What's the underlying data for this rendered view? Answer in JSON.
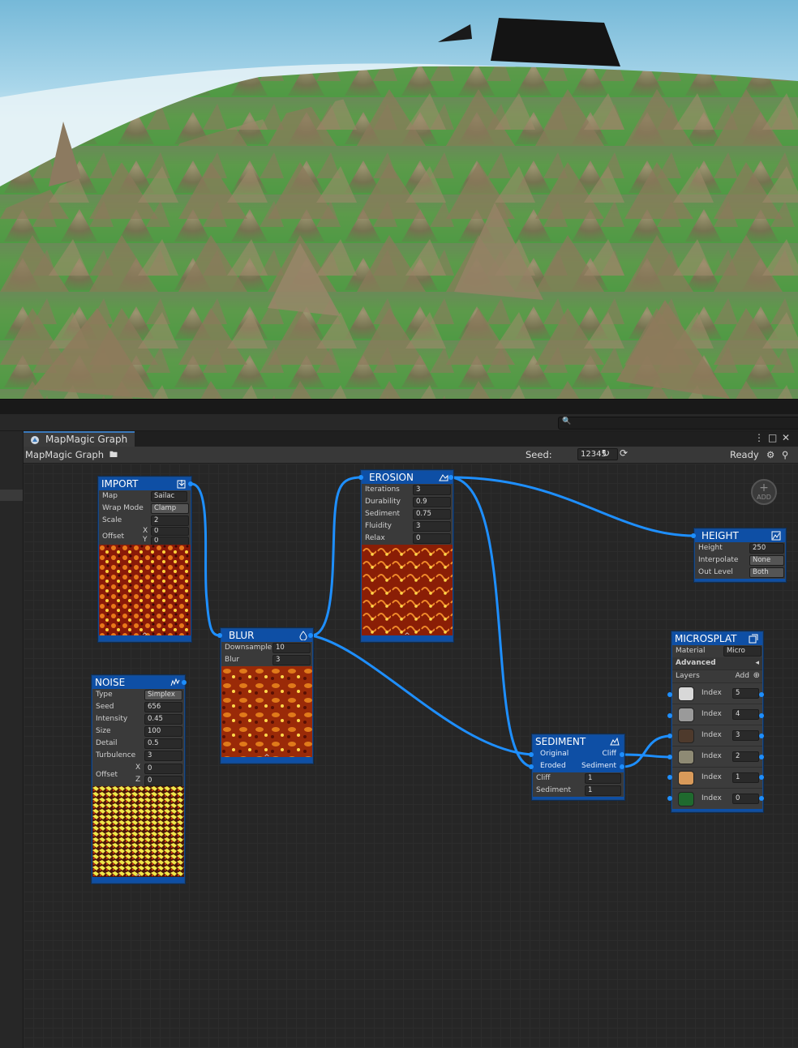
{
  "window": {
    "tab_label": "MapMagic Graph",
    "breadcrumb": "MapMagic Graph",
    "seed_label": "Seed:",
    "seed_value": "12345",
    "status": "Ready"
  },
  "add_button_label": "ADD",
  "nodes": {
    "import": {
      "title": "IMPORT",
      "map_label": "Map",
      "map_value": "Sailac",
      "wrap_label": "Wrap Mode",
      "wrap_value": "Clamp",
      "scale_label": "Scale",
      "scale_value": "2",
      "offset_label": "Offset",
      "x_label": "X",
      "x_value": "0",
      "y_label": "Y",
      "y_value": "0"
    },
    "noise": {
      "title": "NOISE",
      "type_label": "Type",
      "type_value": "Simplex",
      "seed_label": "Seed",
      "seed_value": "656",
      "intensity_label": "Intensity",
      "intensity_value": "0.45",
      "size_label": "Size",
      "size_value": "100",
      "detail_label": "Detail",
      "detail_value": "0.5",
      "turbulence_label": "Turbulence",
      "turbulence_value": "3",
      "offset_label": "Offset",
      "x_label": "X",
      "x_value": "0",
      "z_label": "Z",
      "z_value": "0"
    },
    "blur": {
      "title": "BLUR",
      "downsample_label": "Downsample",
      "downsample_value": "10",
      "blur_label": "Blur",
      "blur_value": "3"
    },
    "erosion": {
      "title": "EROSION",
      "iterations_label": "Iterations",
      "iterations_value": "3",
      "durability_label": "Durability",
      "durability_value": "0.9",
      "sediment_label": "Sediment",
      "sediment_value": "0.75",
      "fluidity_label": "Fluidity",
      "fluidity_value": "3",
      "relax_label": "Relax",
      "relax_value": "0"
    },
    "height": {
      "title": "HEIGHT",
      "height_label": "Height",
      "height_value": "250",
      "interpolate_label": "Interpolate",
      "interpolate_value": "None",
      "outlevel_label": "Out Level",
      "outlevel_value": "Both"
    },
    "sediment": {
      "title": "SEDIMENT",
      "original_label": "Original",
      "cliff_out_label": "Cliff",
      "eroded_label": "Eroded",
      "sediment_out_label": "Sediment",
      "cliff_label": "Cliff",
      "cliff_value": "1",
      "sediment_label": "Sediment",
      "sediment_value": "1"
    },
    "microsplat": {
      "title": "MICROSPLAT",
      "material_label": "Material",
      "material_value": "Micro",
      "advanced_label": "Advanced",
      "layers_label": "Layers",
      "add_label": "Add",
      "layers": [
        {
          "label": "Index",
          "value": "5",
          "color": "#d8d8d8"
        },
        {
          "label": "Index",
          "value": "4",
          "color": "#9a9a9a"
        },
        {
          "label": "Index",
          "value": "3",
          "color": "#4e3a2c"
        },
        {
          "label": "Index",
          "value": "2",
          "color": "#8e8a74"
        },
        {
          "label": "Index",
          "value": "1",
          "color": "#d89a5a"
        },
        {
          "label": "Index",
          "value": "0",
          "color": "#1f6a2e"
        }
      ]
    }
  },
  "colors": {
    "node_header": "#0e4fa5",
    "wire": "#1e8fff"
  }
}
